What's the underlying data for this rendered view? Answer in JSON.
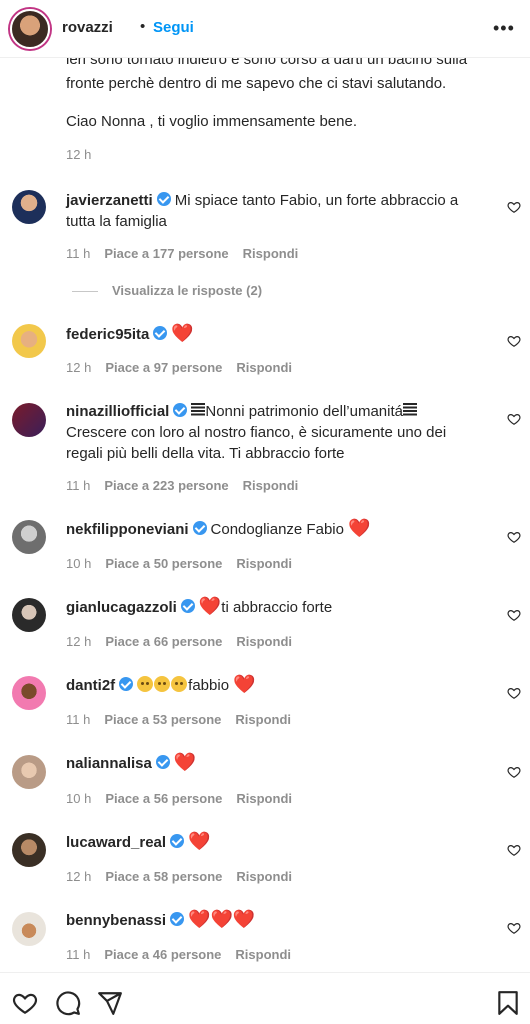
{
  "header": {
    "username": "rovazzi",
    "dot": "•",
    "follow_label": "Segui",
    "more_label": "•••"
  },
  "caption": {
    "line1": "ieri sono tornato indietro e sono corso a darti un bacino sulla",
    "line2": "fronte perchè dentro di me sapevo che ci stavi salutando.",
    "line3": "Ciao Nonna , ti voglio immensamente bene.",
    "time": "12 h"
  },
  "view_replies": "Visualizza le risposte (2)",
  "comments": [
    {
      "user": "javierzanetti",
      "text1": "Mi spiace tanto Fabio, un forte abbraccio a",
      "text2": "tutta la famiglia",
      "time": "11 h",
      "likes": "Piace a 177 persone",
      "reply": "Rispondi"
    },
    {
      "user": "federic95ita",
      "text1": "❤️",
      "time": "12 h",
      "likes": "Piace a 97 persone",
      "reply": "Rispondi"
    },
    {
      "user": "ninazilliofficial",
      "text1": "Nonni patrimonio dell’umanitá",
      "text2": "Crescere con loro al nostro fianco, è sicuramente uno dei",
      "text3": "regali più belli della vita. Ti abbraccio forte",
      "time": "11 h",
      "likes": "Piace a 223 persone",
      "reply": "Rispondi"
    },
    {
      "user": "nekfilipponeviani",
      "text1": "Condoglianze Fabio ",
      "heart": "❤️",
      "time": "10 h",
      "likes": "Piace a 50 persone",
      "reply": "Rispondi"
    },
    {
      "user": "gianlucagazzoli",
      "heart": "❤️",
      "text1": "ti abbraccio forte",
      "time": "12 h",
      "likes": "Piace a 66 persone",
      "reply": "Rispondi"
    },
    {
      "user": "danti2f",
      "text1": "fabbio ",
      "heart": "❤️",
      "time": "11 h",
      "likes": "Piace a 53 persone",
      "reply": "Rispondi"
    },
    {
      "user": "naliannalisa",
      "heart": "❤️",
      "time": "10 h",
      "likes": "Piace a 56 persone",
      "reply": "Rispondi"
    },
    {
      "user": "lucaward_real",
      "heart": "❤️",
      "time": "12 h",
      "likes": "Piace a 58 persone",
      "reply": "Rispondi"
    },
    {
      "user": "bennybenassi",
      "heart": "❤️❤️❤️",
      "time": "11 h",
      "likes": "Piace a 46 persone",
      "reply": "Rispondi"
    }
  ],
  "colors": {
    "accent": "#0095f6",
    "verified": "#3897f0",
    "muted": "#8e8e8e",
    "heart": "#ed1c3c"
  },
  "icons": {
    "like": "heart-icon",
    "comment": "comment-icon",
    "share": "send-icon",
    "save": "bookmark-icon"
  }
}
